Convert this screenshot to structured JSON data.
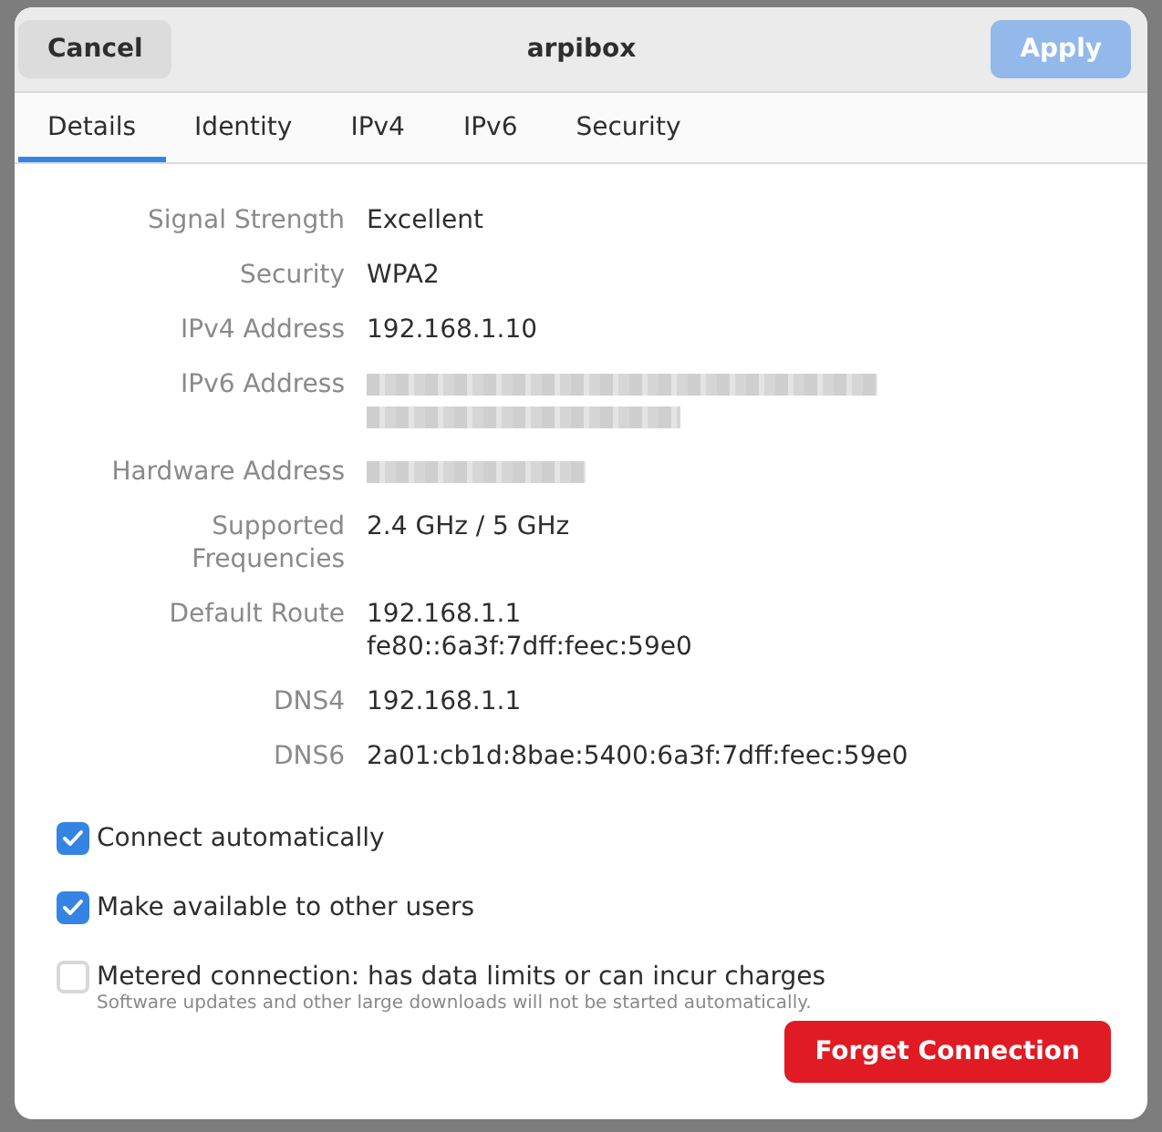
{
  "header": {
    "cancel": "Cancel",
    "title": "arpibox",
    "apply": "Apply",
    "apply_disabled": true
  },
  "tabs": [
    {
      "label": "Details",
      "selected": true
    },
    {
      "label": "Identity",
      "selected": false
    },
    {
      "label": "IPv4",
      "selected": false
    },
    {
      "label": "IPv6",
      "selected": false
    },
    {
      "label": "Security",
      "selected": false
    }
  ],
  "details": [
    {
      "label": "Signal Strength",
      "kind": "text",
      "lines": [
        "Excellent"
      ]
    },
    {
      "label": "Security",
      "kind": "text",
      "lines": [
        "WPA2"
      ]
    },
    {
      "label": "IPv4 Address",
      "kind": "text",
      "lines": [
        "192.168.1.10"
      ]
    },
    {
      "label": "IPv6 Address",
      "kind": "blurred-long"
    },
    {
      "label": "Hardware Address",
      "kind": "blurred"
    },
    {
      "label": "Supported Frequencies",
      "kind": "text",
      "lines": [
        "2.4 GHz / 5 GHz"
      ]
    },
    {
      "label": "Default Route",
      "kind": "text",
      "lines": [
        "192.168.1.1",
        "fe80::6a3f:7dff:feec:59e0"
      ]
    },
    {
      "label": "DNS4",
      "kind": "text",
      "lines": [
        "192.168.1.1"
      ]
    },
    {
      "label": "DNS6",
      "kind": "text",
      "lines": [
        "2a01:cb1d:8bae:5400:6a3f:7dff:feec:59e0"
      ]
    }
  ],
  "options": [
    {
      "label": "Connect automatically",
      "checked": true
    },
    {
      "label": "Make available to other users",
      "checked": true
    },
    {
      "label": "Metered connection: has data limits or can incur charges",
      "checked": false,
      "note": "Software updates and other large downloads will not be started automatically."
    }
  ],
  "forget": "Forget Connection"
}
